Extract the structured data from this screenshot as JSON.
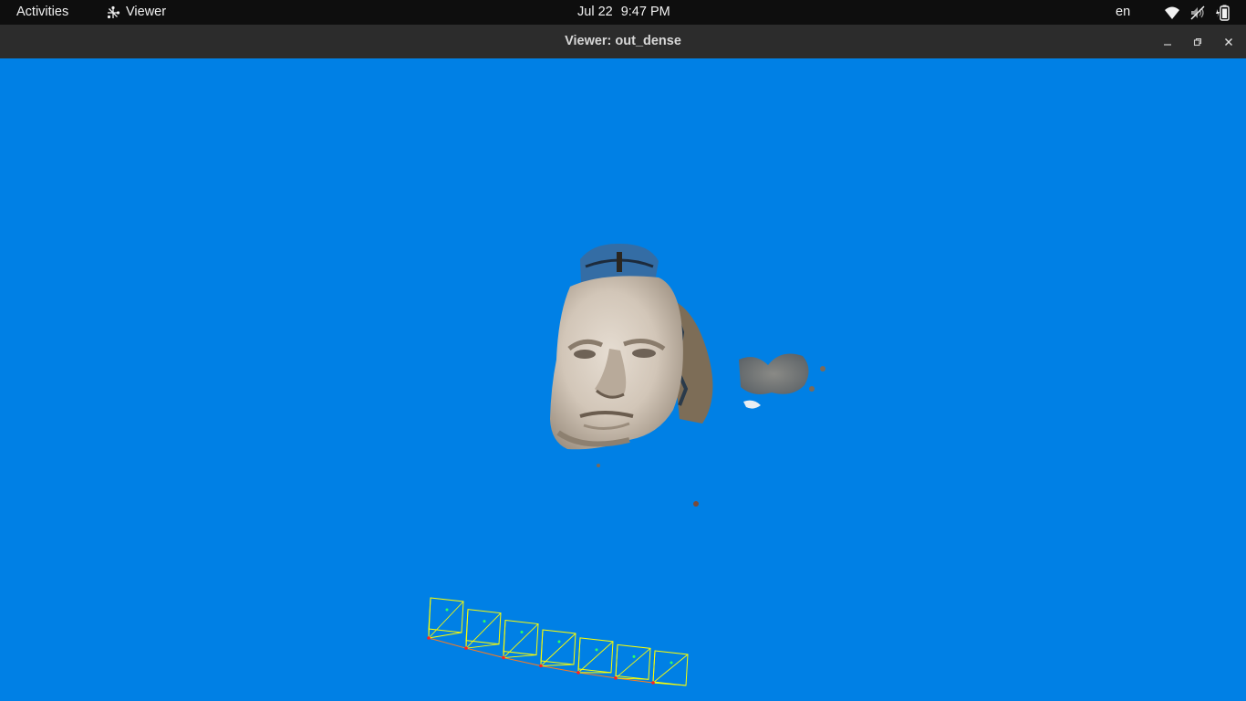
{
  "topbar": {
    "activities": "Activities",
    "app_name": "Viewer",
    "date": "Jul 22",
    "time": "9:47 PM",
    "language": "en",
    "icons": [
      "wifi-icon",
      "volume-muted-icon",
      "battery-icon"
    ]
  },
  "window": {
    "title": "Viewer: out_dense",
    "controls": [
      "minimize-icon",
      "maximize-icon",
      "close-icon"
    ]
  },
  "viewport": {
    "background_color": "#0080e5",
    "content": "dense point cloud of a sculpted head with camera frustums",
    "frustum_color": "#ffff00",
    "camera_center_color": "#ff2020",
    "trajectory_color": "#ff7a1a",
    "frustum_count": 7
  }
}
